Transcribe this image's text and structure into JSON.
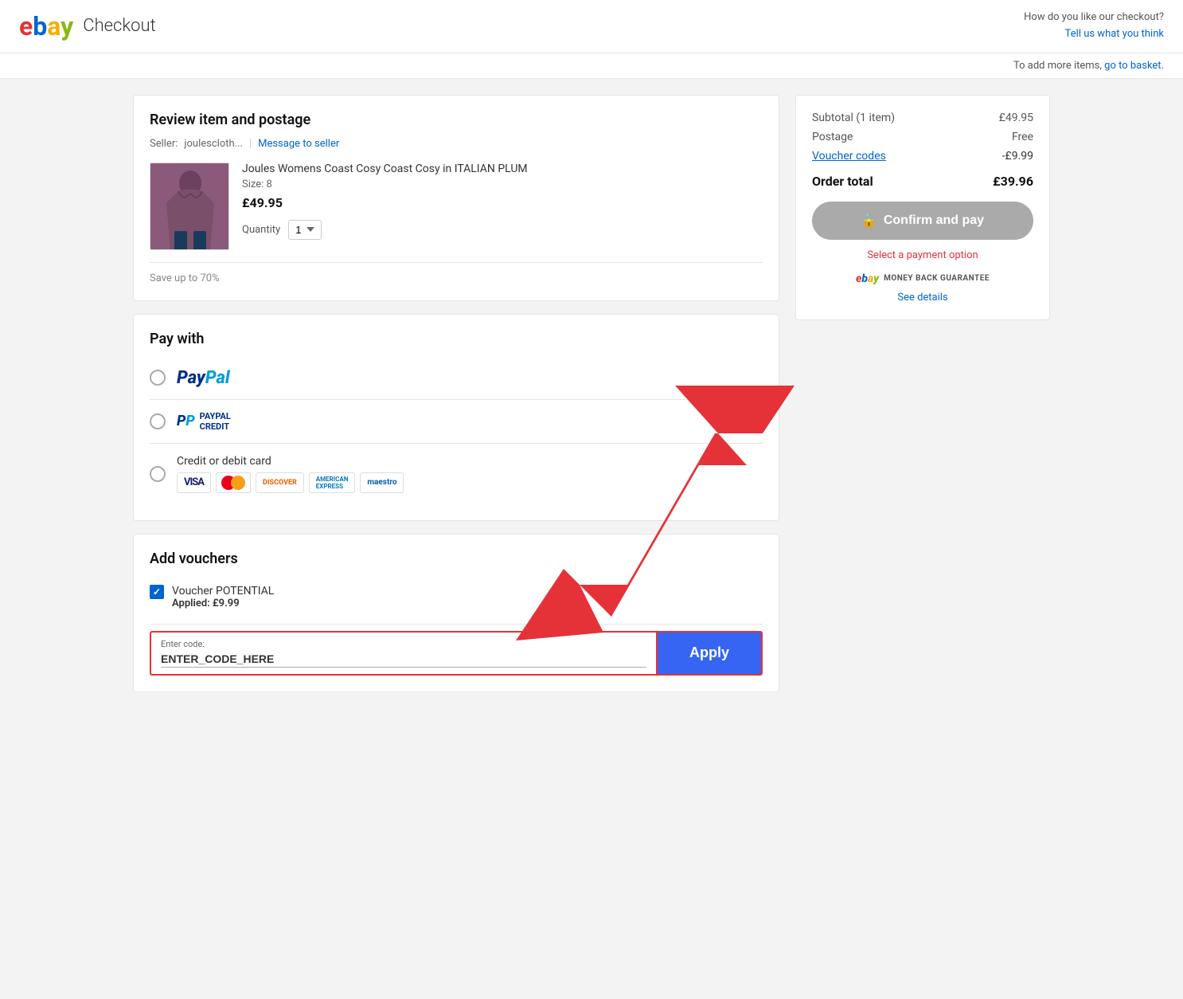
{
  "header": {
    "logo_e": "e",
    "logo_b": "b",
    "logo_a": "a",
    "logo_y": "y",
    "title": "Checkout",
    "feedback_question": "How do you like our checkout?",
    "feedback_link": "Tell us what you think",
    "basket_notice": "To add more items,",
    "basket_link": "go to basket",
    "basket_link_suffix": "."
  },
  "item_section": {
    "title": "Review item and postage",
    "seller_label": "Seller:",
    "seller_name": "joulescloth...",
    "message_link": "Message to seller",
    "item_name": "Joules Womens Coast Cosy Coast Cosy in ITALIAN PLUM",
    "item_size": "Size: 8",
    "item_price": "£49.95",
    "quantity_label": "Quantity",
    "quantity_value": "1",
    "save_text": "Save up to 70%"
  },
  "payment_section": {
    "title": "Pay with",
    "options": [
      {
        "id": "paypal",
        "label": "PayPal"
      },
      {
        "id": "paypal-credit",
        "label": "PayPal Credit"
      },
      {
        "id": "card",
        "label": "Credit or debit card"
      }
    ],
    "card_types": [
      "VISA",
      "MC",
      "DISCOVER",
      "AMEX",
      "Maestro"
    ]
  },
  "voucher_section": {
    "title": "Add vouchers",
    "voucher_name": "Voucher POTENTIAL",
    "voucher_applied": "Applied: £9.99",
    "enter_code_label": "Enter code:",
    "enter_code_value": "ENTER_CODE_HERE",
    "apply_button": "Apply"
  },
  "order_summary": {
    "subtotal_label": "Subtotal (1 item)",
    "subtotal_value": "£49.95",
    "postage_label": "Postage",
    "postage_value": "Free",
    "voucher_label": "Voucher codes",
    "voucher_value": "-£9.99",
    "total_label": "Order total",
    "total_value": "£39.96",
    "confirm_button": "Confirm and pay",
    "payment_required": "Select a payment option",
    "money_back": "MONEY BACK GUARANTEE",
    "see_details": "See details"
  }
}
